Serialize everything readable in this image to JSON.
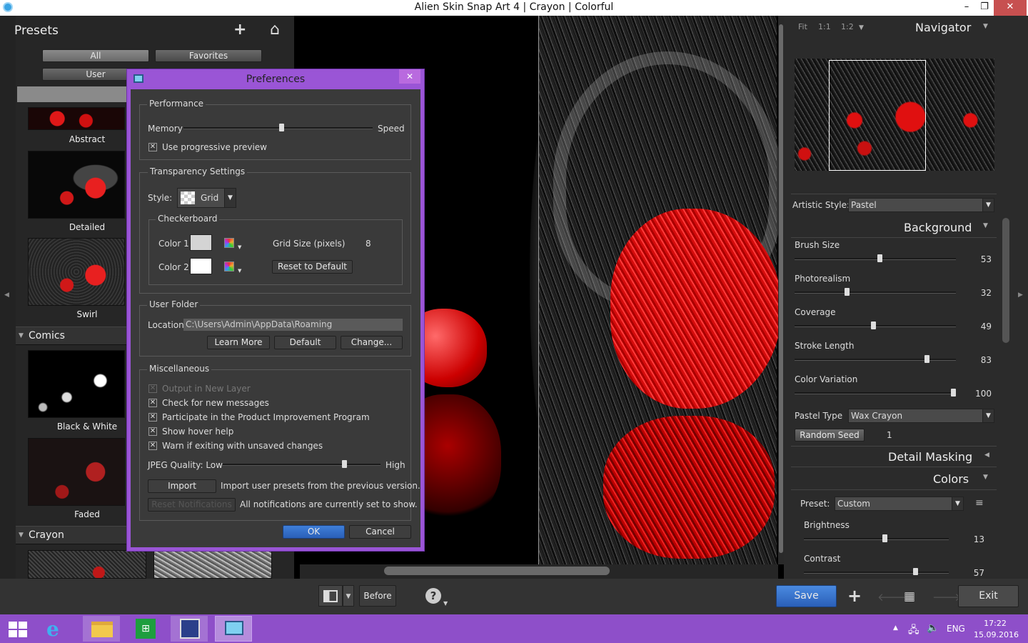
{
  "window": {
    "title": "Alien Skin Snap Art 4 | Crayon | Colorful",
    "minimize": "–",
    "restore": "❐",
    "close": "✕"
  },
  "presets": {
    "title": "Presets",
    "add_icon": "+",
    "home_icon": "⌂",
    "filters": [
      "All",
      "Favorites",
      "User"
    ],
    "items": [
      {
        "label": "Abstract"
      },
      {
        "label": "Detailed"
      },
      {
        "label": "Swirl"
      }
    ],
    "categories": [
      "Comics",
      "Crayon"
    ],
    "comics_items": [
      {
        "label": "Black & White"
      },
      {
        "label": "Faded"
      }
    ]
  },
  "navigator": {
    "zoom_fit": "Fit",
    "zoom_1_1": "1:1",
    "zoom_1_2": "1:2",
    "title": "Navigator"
  },
  "settings": {
    "artistic_style_label": "Artistic Style:",
    "artistic_style_value": "Pastel",
    "background_title": "Background",
    "sliders": [
      {
        "label": "Brush Size",
        "value": "53",
        "level": 53
      },
      {
        "label": "Photorealism",
        "value": "32",
        "level": 32
      },
      {
        "label": "Coverage",
        "value": "49",
        "level": 49
      },
      {
        "label": "Stroke Length",
        "value": "83",
        "level": 83
      },
      {
        "label": "Color Variation",
        "value": "100",
        "level": 100
      }
    ],
    "pastel_type_label": "Pastel Type",
    "pastel_type_value": "Wax Crayon",
    "random_seed_label": "Random Seed",
    "random_seed_value": "1",
    "detail_masking_title": "Detail Masking",
    "colors_title": "Colors",
    "preset_label": "Preset:",
    "preset_value": "Custom",
    "brightness_label": "Brightness",
    "brightness_value": "13",
    "brightness_level": 56,
    "contrast_label": "Contrast",
    "contrast_value": "57",
    "contrast_level": 78
  },
  "bottom": {
    "before_label": "Before",
    "help_icon": "?",
    "save_label": "Save",
    "exit_label": "Exit"
  },
  "dialog": {
    "title": "Preferences",
    "performance": {
      "title": "Performance",
      "memory_label": "Memory",
      "speed_label": "Speed",
      "level": 52,
      "progressive_label": "Use progressive preview",
      "progressive_checked": true
    },
    "transparency": {
      "title": "Transparency Settings",
      "style_label": "Style:",
      "style_value": "Grid",
      "checkerboard_title": "Checkerboard",
      "color1_label": "Color 1",
      "color1": "#d4d4d4",
      "color2_label": "Color 2",
      "color2": "#ffffff",
      "grid_size_label": "Grid Size (pixels)",
      "grid_size_value": "8",
      "reset_label": "Reset to Default"
    },
    "user_folder": {
      "title": "User Folder",
      "location_label": "Location",
      "location_value": "C:\\Users\\Admin\\AppData\\Roaming",
      "learn_more": "Learn More",
      "default": "Default",
      "change": "Change..."
    },
    "misc": {
      "title": "Miscellaneous",
      "checks": [
        {
          "label": "Output in New Layer",
          "checked": true,
          "disabled": true
        },
        {
          "label": "Check for new messages",
          "checked": true,
          "disabled": false
        },
        {
          "label": "Participate in the Product Improvement Program",
          "checked": true,
          "disabled": false
        },
        {
          "label": "Show hover help",
          "checked": true,
          "disabled": false
        },
        {
          "label": "Warn if exiting with unsaved changes",
          "checked": true,
          "disabled": false
        }
      ],
      "jpeg_label": "JPEG Quality: Low",
      "jpeg_high": "High",
      "jpeg_level": 78,
      "import_label": "Import",
      "import_text": "Import user presets from the previous version.",
      "reset_notif_label": "Reset Notifications",
      "notif_text": "All notifications are currently set to show."
    },
    "ok": "OK",
    "cancel": "Cancel"
  },
  "taskbar": {
    "lang": "ENG",
    "time": "17:22",
    "date": "15.09.2016"
  }
}
